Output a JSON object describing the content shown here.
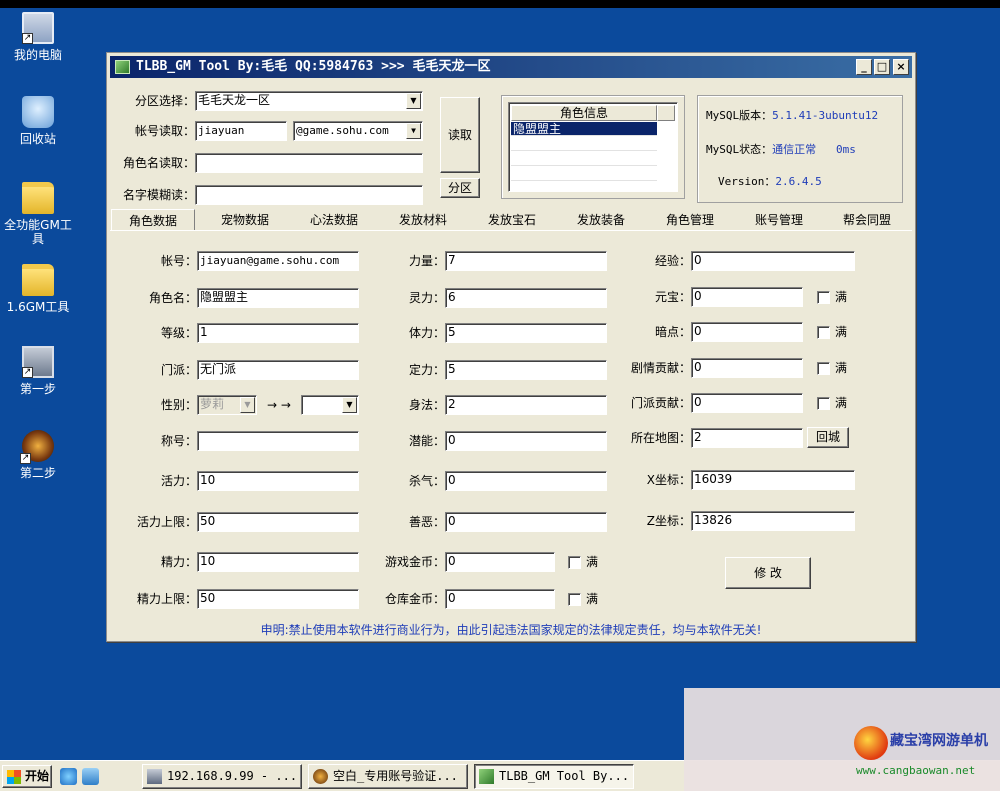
{
  "desktop": {
    "icons": [
      {
        "label": "我的电脑"
      },
      {
        "label": "回收站"
      },
      {
        "label": "全功能GM工具"
      },
      {
        "label": "1.6GM工具"
      },
      {
        "label": "第一步"
      },
      {
        "label": "第二步"
      }
    ]
  },
  "window": {
    "title": "TLBB_GM Tool By:毛毛 QQ:5984763 >>> 毛毛天龙一区",
    "minimize": "_",
    "maximize": "□",
    "close": "×"
  },
  "top_form": {
    "zone_label": "分区选择：",
    "zone_value": "毛毛天龙一区",
    "account_label": "帐号读取：",
    "account_value": "jiayuan",
    "domain_value": "@game.sohu.com",
    "role_name_label": "角色名读取：",
    "role_name_value": "",
    "fuzzy_label": "名字模糊读：",
    "fuzzy_value": "",
    "read_button": "读取",
    "zone_button": "分区"
  },
  "role_list": {
    "header": "角色信息",
    "rows": [
      "隐盟盟主"
    ]
  },
  "mysql_info": {
    "version_label": "MySQL版本：",
    "version_value": "5.1.41-3ubuntu12",
    "status_label": "MySQL状态：",
    "status_value": "通信正常",
    "status_ms": "0ms",
    "version2_label": "Version：",
    "version2_value": "2.6.4.5"
  },
  "tabs": [
    "角色数据",
    "宠物数据",
    "心法数据",
    "发放材料",
    "发放宝石",
    "发放装备",
    "角色管理",
    "账号管理",
    "帮会同盟"
  ],
  "col1": {
    "account_label": "帐号：",
    "account_value": "jiayuan@game.sohu.com",
    "name_label": "角色名：",
    "name_value": "隐盟盟主",
    "level_label": "等级：",
    "level_value": "1",
    "sect_label": "门派：",
    "sect_value": "无门派",
    "gender_label": "性别：",
    "gender_value": "萝莉",
    "arrow": "→ →",
    "gender_target": "",
    "title_label": "称号：",
    "title_value": "",
    "vitality_label": "活力：",
    "vitality_value": "10",
    "vitality_max_label": "活力上限：",
    "vitality_max_value": "50",
    "energy_label": "精力：",
    "energy_value": "10",
    "energy_max_label": "精力上限：",
    "energy_max_value": "50"
  },
  "col2": {
    "str_label": "力量：",
    "str_value": "7",
    "spi_label": "灵力：",
    "spi_value": "6",
    "con_label": "体力：",
    "con_value": "5",
    "int_label": "定力：",
    "int_value": "5",
    "dex_label": "身法：",
    "dex_value": "2",
    "pot_label": "潜能：",
    "pot_value": "0",
    "kill_label": "杀气：",
    "kill_value": "0",
    "morality_label": "善恶：",
    "morality_value": "0",
    "game_gold_label": "游戏金币：",
    "game_gold_value": "0",
    "bank_gold_label": "仓库金币：",
    "bank_gold_value": "0",
    "full_label": "满"
  },
  "col3": {
    "exp_label": "经验：",
    "exp_value": "0",
    "yuanbao_label": "元宝：",
    "yuanbao_value": "0",
    "secret_label": "暗点：",
    "secret_value": "0",
    "story_label": "剧情贡献：",
    "story_value": "0",
    "sect_contrib_label": "门派贡献：",
    "sect_contrib_value": "0",
    "map_label": "所在地图：",
    "map_value": "2",
    "return_button": "回城",
    "x_label": "X坐标：",
    "x_value": "16039",
    "z_label": "Z坐标：",
    "z_value": "13826",
    "full_label": "满",
    "modify_button": "修 改"
  },
  "notice": "申明:禁止使用本软件进行商业行为，由此引起违法国家规定的法律规定责任，均与本软件无关!",
  "taskbar": {
    "start": "开始",
    "tasks": [
      "192.168.9.99 - ...",
      "空白_专用账号验证...",
      "TLBB_GM Tool By..."
    ]
  },
  "watermark": {
    "title": "藏宝湾网游单机",
    "url": "www.cangbaowan.net"
  }
}
